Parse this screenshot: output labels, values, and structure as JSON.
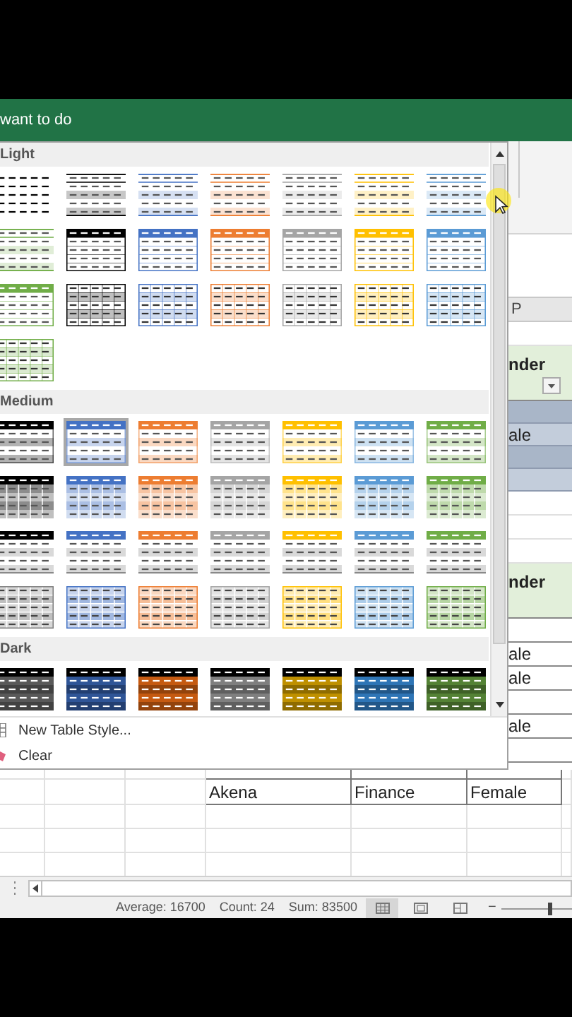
{
  "ribbon": {
    "search_hint": "want to do"
  },
  "table_styles": {
    "groups": [
      {
        "title": "Light",
        "styles": [
          {
            "kind": "plain",
            "color": "#000000",
            "selected": false
          },
          {
            "kind": "lines",
            "color": "#000000",
            "selected": false
          },
          {
            "kind": "lines",
            "color": "#4472c4",
            "selected": false
          },
          {
            "kind": "lines",
            "color": "#ed7d31",
            "selected": false
          },
          {
            "kind": "lines",
            "color": "#a5a5a5",
            "selected": false
          },
          {
            "kind": "lines",
            "color": "#ffc000",
            "selected": false
          },
          {
            "kind": "lines",
            "color": "#5b9bd5",
            "selected": false
          },
          {
            "kind": "lines",
            "color": "#70ad47",
            "selected": false
          },
          {
            "kind": "header",
            "color": "#000000",
            "selected": false
          },
          {
            "kind": "header",
            "color": "#4472c4",
            "selected": false
          },
          {
            "kind": "header",
            "color": "#ed7d31",
            "selected": false
          },
          {
            "kind": "header",
            "color": "#a5a5a5",
            "selected": false
          },
          {
            "kind": "header",
            "color": "#ffc000",
            "selected": false
          },
          {
            "kind": "header",
            "color": "#5b9bd5",
            "selected": false
          },
          {
            "kind": "header",
            "color": "#70ad47",
            "selected": false
          },
          {
            "kind": "grid",
            "color": "#000000",
            "selected": false
          },
          {
            "kind": "grid",
            "color": "#4472c4",
            "selected": false
          },
          {
            "kind": "grid",
            "color": "#ed7d31",
            "selected": false
          },
          {
            "kind": "grid",
            "color": "#a5a5a5",
            "selected": false
          },
          {
            "kind": "grid",
            "color": "#ffc000",
            "selected": false
          },
          {
            "kind": "grid",
            "color": "#5b9bd5",
            "selected": false
          },
          {
            "kind": "grid",
            "color": "#70ad47",
            "selected": false
          }
        ]
      },
      {
        "title": "Medium",
        "styles": [
          {
            "kind": "banded",
            "color": "#000000",
            "selected": false
          },
          {
            "kind": "banded",
            "color": "#4472c4",
            "selected": true
          },
          {
            "kind": "banded",
            "color": "#ed7d31",
            "selected": false
          },
          {
            "kind": "banded",
            "color": "#a5a5a5",
            "selected": false
          },
          {
            "kind": "banded",
            "color": "#ffc000",
            "selected": false
          },
          {
            "kind": "banded",
            "color": "#5b9bd5",
            "selected": false
          },
          {
            "kind": "banded",
            "color": "#70ad47",
            "selected": false
          },
          {
            "kind": "filled",
            "color": "#000000",
            "selected": false
          },
          {
            "kind": "filled",
            "color": "#4472c4",
            "selected": false
          },
          {
            "kind": "filled",
            "color": "#ed7d31",
            "selected": false
          },
          {
            "kind": "filled",
            "color": "#a5a5a5",
            "selected": false
          },
          {
            "kind": "filled",
            "color": "#ffc000",
            "selected": false
          },
          {
            "kind": "filled",
            "color": "#5b9bd5",
            "selected": false
          },
          {
            "kind": "filled",
            "color": "#70ad47",
            "selected": false
          },
          {
            "kind": "ruled",
            "color": "#000000",
            "selected": false
          },
          {
            "kind": "ruled",
            "color": "#4472c4",
            "selected": false
          },
          {
            "kind": "ruled",
            "color": "#ed7d31",
            "selected": false
          },
          {
            "kind": "ruled",
            "color": "#a5a5a5",
            "selected": false
          },
          {
            "kind": "ruled",
            "color": "#ffc000",
            "selected": false
          },
          {
            "kind": "ruled",
            "color": "#5b9bd5",
            "selected": false
          },
          {
            "kind": "ruled",
            "color": "#70ad47",
            "selected": false
          },
          {
            "kind": "gridfill",
            "color": "#7f7f7f",
            "selected": false
          },
          {
            "kind": "gridfill",
            "color": "#4472c4",
            "selected": false
          },
          {
            "kind": "gridfill",
            "color": "#ed7d31",
            "selected": false
          },
          {
            "kind": "gridfill",
            "color": "#a5a5a5",
            "selected": false
          },
          {
            "kind": "gridfill",
            "color": "#ffc000",
            "selected": false
          },
          {
            "kind": "gridfill",
            "color": "#5b9bd5",
            "selected": false
          },
          {
            "kind": "gridfill",
            "color": "#70ad47",
            "selected": false
          }
        ]
      },
      {
        "title": "Dark",
        "styles": [
          {
            "kind": "dark",
            "color": "#595959",
            "selected": false
          },
          {
            "kind": "dark",
            "color": "#2f5597",
            "selected": false
          },
          {
            "kind": "dark",
            "color": "#c55a11",
            "selected": false
          },
          {
            "kind": "dark",
            "color": "#7f7f7f",
            "selected": false
          },
          {
            "kind": "dark",
            "color": "#bf9000",
            "selected": false
          },
          {
            "kind": "dark",
            "color": "#2e75b6",
            "selected": false
          },
          {
            "kind": "dark",
            "color": "#548235",
            "selected": false
          }
        ]
      }
    ],
    "menu_items": [
      {
        "kind": "new",
        "label": "New Table Style..."
      },
      {
        "kind": "clear",
        "label": "Clear"
      }
    ]
  },
  "sheet": {
    "column_header": "P",
    "side_cells": [
      {
        "kind": "blank"
      },
      {
        "kind": "header",
        "text": "nder"
      },
      {
        "kind": "band"
      },
      {
        "kind": "band_light",
        "text": "ale"
      },
      {
        "kind": "band"
      },
      {
        "kind": "band_light"
      },
      {
        "kind": "blank"
      },
      {
        "kind": "blank"
      },
      {
        "kind": "blank"
      },
      {
        "kind": "header",
        "text": "nder"
      },
      {
        "kind": "data"
      },
      {
        "kind": "data",
        "text": "ale"
      },
      {
        "kind": "data",
        "text": "ale"
      },
      {
        "kind": "data"
      },
      {
        "kind": "data",
        "text": "ale"
      },
      {
        "kind": "data"
      }
    ],
    "rows": [
      [
        "Akena",
        "Finance",
        "Female"
      ]
    ]
  },
  "status_bar": {
    "average": "Average: 16700",
    "count": "Count: 24",
    "sum": "Sum: 83500",
    "views": [
      {
        "kind": "normal",
        "selected": true
      },
      {
        "kind": "page_layout",
        "selected": false
      },
      {
        "kind": "page_break",
        "selected": false
      }
    ],
    "zoom_out": "−",
    "zoom": {
      "level": 0.67
    }
  }
}
